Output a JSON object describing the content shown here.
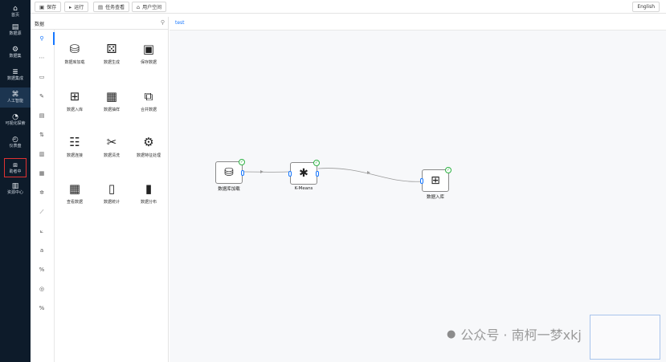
{
  "nav": {
    "items": [
      {
        "icon": "home-icon",
        "glyph": "⌂",
        "label": "首页"
      },
      {
        "icon": "document-icon",
        "glyph": "▤",
        "label": ""
      },
      {
        "icon": "datasource-icon",
        "glyph": "",
        "label": "数据源"
      },
      {
        "icon": "dataset-icon",
        "glyph": "⚙",
        "label": "数据集"
      },
      {
        "icon": "integration-icon",
        "glyph": "≣",
        "label": "数据集成"
      },
      {
        "icon": "ai-icon",
        "glyph": "⌘",
        "label": "人工智能"
      },
      {
        "icon": "visual-explore-icon",
        "glyph": "◔",
        "label": "可视化探索"
      },
      {
        "icon": "dashboard-icon",
        "glyph": "◴",
        "label": "仪表盘"
      },
      {
        "icon": "workflow-icon",
        "glyph": "⧈",
        "label": "助者中"
      },
      {
        "icon": "resource-icon",
        "glyph": "▥",
        "label": "资源中心"
      }
    ]
  },
  "toolbar": {
    "save": "保存",
    "run": "运行",
    "task_view": "任务查看",
    "user_space": "用户空间",
    "language": "English"
  },
  "panel": {
    "title": "数据",
    "categories": [
      {
        "glyph": "⚲"
      },
      {
        "glyph": "⋯"
      },
      {
        "glyph": "▭"
      },
      {
        "glyph": "✎"
      },
      {
        "glyph": "▤"
      },
      {
        "glyph": "⇅"
      },
      {
        "glyph": "▥"
      },
      {
        "glyph": "▦"
      },
      {
        "glyph": "✲"
      },
      {
        "glyph": "⟋"
      },
      {
        "glyph": "⟀"
      },
      {
        "glyph": "a"
      },
      {
        "glyph": "%"
      },
      {
        "glyph": "◎"
      },
      {
        "glyph": "%"
      }
    ],
    "components": [
      {
        "name": "database-load-icon",
        "glyph": "⛁",
        "label": "数据库加载"
      },
      {
        "name": "data-generate-icon",
        "glyph": "⚄",
        "label": "数据生成"
      },
      {
        "name": "save-data-icon",
        "glyph": "▣",
        "label": "保存数据"
      },
      {
        "name": "data-import-icon",
        "glyph": "⊞",
        "label": "数据入库"
      },
      {
        "name": "data-sample-icon",
        "glyph": "▦",
        "label": "数据抽样"
      },
      {
        "name": "merge-data-icon",
        "glyph": "⧉",
        "label": "合并数据"
      },
      {
        "name": "data-join-icon",
        "glyph": "☷",
        "label": "数据连接"
      },
      {
        "name": "data-clean-icon",
        "glyph": "✂",
        "label": "数据清洗"
      },
      {
        "name": "feature-process-icon",
        "glyph": "⚙",
        "label": "数据特征处理"
      },
      {
        "name": "view-data-icon",
        "glyph": "▦",
        "label": "查看数据"
      },
      {
        "name": "data-stats-icon",
        "glyph": "▯",
        "label": "数据统计"
      },
      {
        "name": "data-distribution-icon",
        "glyph": "▮",
        "label": "数据分布"
      }
    ]
  },
  "canvas": {
    "tab": "test",
    "nodes": [
      {
        "name": "node-database-load",
        "glyph": "⛁",
        "label": "数据库加载"
      },
      {
        "name": "node-kmeans",
        "glyph": "✱",
        "label": "K-Means"
      },
      {
        "name": "node-data-import",
        "glyph": "⊞",
        "label": "数据入库"
      }
    ]
  },
  "watermark": {
    "icon": "wechat-icon",
    "text": "公众号 · 南柯一梦xkj"
  },
  "colors": {
    "accent": "#1677ff",
    "nav_bg": "#0d1b2a",
    "status_ok": "#2fb344",
    "highlight": "#e03131"
  }
}
